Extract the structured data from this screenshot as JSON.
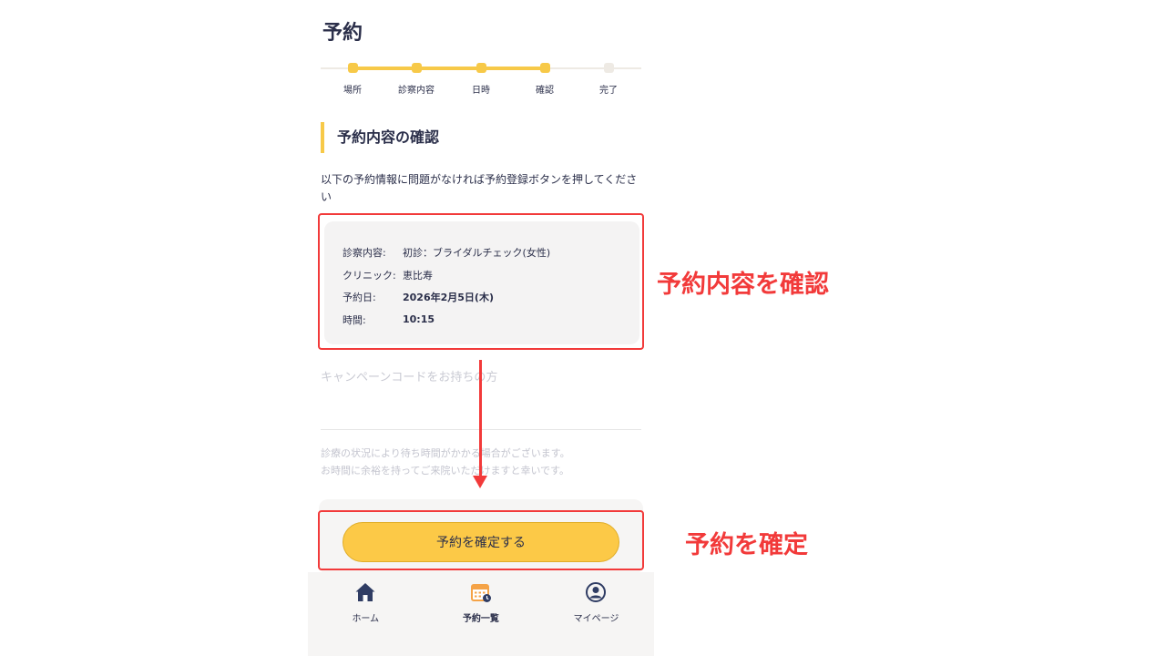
{
  "header": {
    "title": "予約"
  },
  "stepper": {
    "steps": [
      {
        "label": "場所",
        "done": true
      },
      {
        "label": "診察内容",
        "done": true
      },
      {
        "label": "日時",
        "done": true
      },
      {
        "label": "確認",
        "done": true
      },
      {
        "label": "完了",
        "done": false
      }
    ]
  },
  "section": {
    "title": "予約内容の確認",
    "intro": "以下の予約情報に問題がなければ予約登録ボタンを押してください"
  },
  "summary": {
    "rows": [
      {
        "label": "診察内容:",
        "value": "初診：ブライダルチェック(女性)"
      },
      {
        "label": "クリニック:",
        "value": "恵比寿"
      },
      {
        "label": "予約日:",
        "value": "2026年2月5日(木)"
      },
      {
        "label": "時間:",
        "value": "10:15"
      }
    ]
  },
  "campaign": {
    "placeholder": "キャンペーンコードをお持ちの方"
  },
  "note": {
    "line1": "診療の状況により待ち時間がかかる場合がございます。",
    "line2": "お時間に余裕を持ってご来院いただけますと幸いです。"
  },
  "cta": {
    "confirm_label": "予約を確定する"
  },
  "nav": {
    "items": [
      {
        "label": "ホーム",
        "icon": "home-icon"
      },
      {
        "label": "予約一覧",
        "icon": "calendar-icon",
        "active": true
      },
      {
        "label": "マイページ",
        "icon": "user-icon"
      }
    ]
  },
  "annotations": {
    "review_label": "予約内容を確認",
    "confirm_label": "予約を確定",
    "color": "#f23a3a"
  },
  "colors": {
    "accent": "#f7c948",
    "button": "#fcc947",
    "text": "#2b2f4a"
  }
}
